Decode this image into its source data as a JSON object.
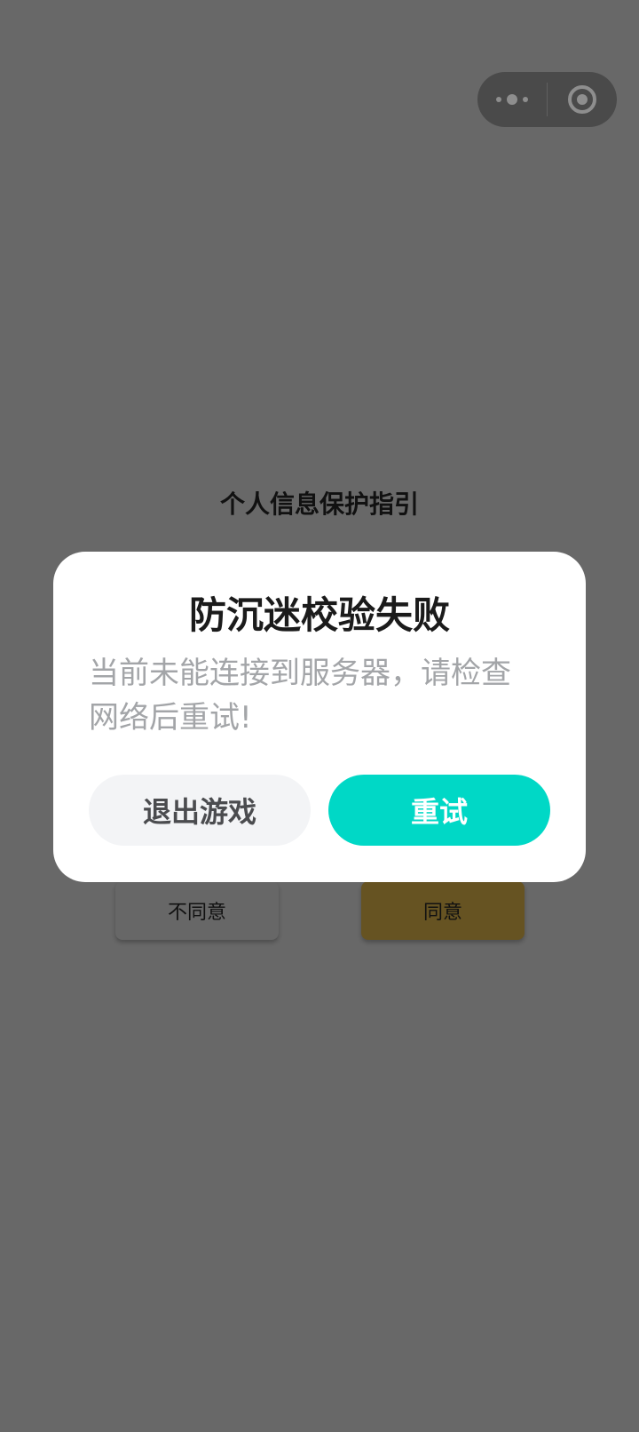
{
  "background_page": {
    "title": "个人信息保护指引",
    "disagree_label": "不同意",
    "agree_label": "同意"
  },
  "capsule": {
    "more_icon": "more-dots-icon",
    "close_icon": "close-circle-icon"
  },
  "dialog": {
    "title": "防沉迷校验失败",
    "message": "当前未能连接到服务器，请检查网络后重试!",
    "exit_label": "退出游戏",
    "retry_label": "重试"
  },
  "colors": {
    "overlay_bg": "#686868",
    "retry_button": "#00d8c6",
    "exit_button": "#f3f4f6",
    "agree_button_dimmed": "#665322"
  }
}
